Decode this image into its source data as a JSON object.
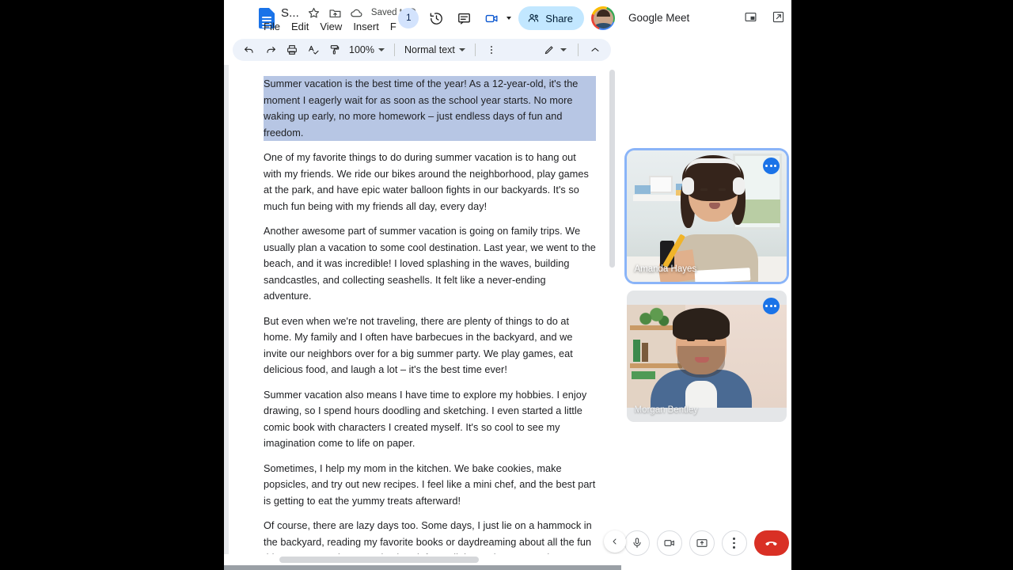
{
  "docs": {
    "doc_title": "S...",
    "saved_status": "Saved to D",
    "menus": [
      "File",
      "Edit",
      "View",
      "Insert",
      "F"
    ],
    "page_badge": "1",
    "share_label": "Share",
    "icons": {
      "app": "docs-file-icon",
      "star": "star-icon",
      "move": "move-to-folder-icon",
      "cloud": "cloud-saved-icon",
      "history": "version-history-icon",
      "comment": "comment-icon",
      "meet": "meet-camera-icon",
      "share": "share-people-icon",
      "avatar": "account-avatar"
    },
    "toolbar": {
      "undo": "undo-icon",
      "redo": "redo-icon",
      "print": "print-icon",
      "spellcheck": "spellcheck-icon",
      "paint": "paint-format-icon",
      "zoom_value": "100%",
      "style_value": "Normal text",
      "more": "more-vertical-icon",
      "editing_mode": "pen-edit-icon",
      "collapse": "chevron-up-icon"
    },
    "document": {
      "paragraphs": [
        "Summer vacation is the best time of the year! As a 12-year-old, it's the moment I eagerly wait for as soon as the school year starts. No more waking up early, no more homework – just endless days of fun and freedom.",
        "One of my favorite things to do during summer vacation is to hang out with my friends. We ride our bikes around the neighborhood, play games at the park, and have epic water balloon fights in our backyards. It's so much fun being with my friends all day, every day!",
        "Another awesome part of summer vacation is going on family trips. We usually plan a vacation to some cool destination. Last year, we went to the beach, and it was incredible! I loved splashing in the waves, building sandcastles, and collecting seashells. It felt like a never-ending adventure.",
        "But even when we're not traveling, there are plenty of things to do at home. My family and I often have barbecues in the backyard, and we invite our neighbors over for a big summer party. We play games, eat delicious food, and laugh a lot – it's the best time ever!",
        "Summer vacation also means I have time to explore my hobbies. I enjoy drawing, so I spend hours doodling and sketching. I even started a little comic book with characters I created myself. It's so cool to see my imagination come to life on paper.",
        "Sometimes, I help my mom in the kitchen. We bake cookies, make popsicles, and try out new recipes. I feel like a mini chef, and the best part is getting to eat the yummy treats afterward!",
        "Of course, there are lazy days too. Some days, I just lie on a hammock in the backyard, reading my favorite books or daydreaming about all the fun things I want to do. It's a nice break from all the excitement, and I get to relax and recharge."
      ],
      "selected_paragraph_index": 0
    }
  },
  "meet": {
    "title": "Google Meet",
    "header_icons": {
      "pip": "picture-in-picture-icon",
      "open_new": "open-in-new-icon"
    },
    "participants": [
      {
        "name": "Amanda Hayes",
        "speaking": true,
        "options_label": "more-options"
      },
      {
        "name": "Morgan Bentley",
        "speaking": false,
        "options_label": "more-options"
      }
    ],
    "controls": {
      "mic": "microphone-icon",
      "camera": "camera-icon",
      "present": "present-screen-icon",
      "more": "more-options-icon",
      "leave": "leave-call-icon",
      "collapse": "collapse-panel-icon"
    }
  },
  "colors": {
    "docs_blue": "#1a73e8",
    "share_bg": "#c2e7ff",
    "toolbar_bg": "#edf2fa",
    "selection": "#b7c6e4",
    "speaking_border": "#8ab4f8",
    "leave_red": "#d93025"
  }
}
